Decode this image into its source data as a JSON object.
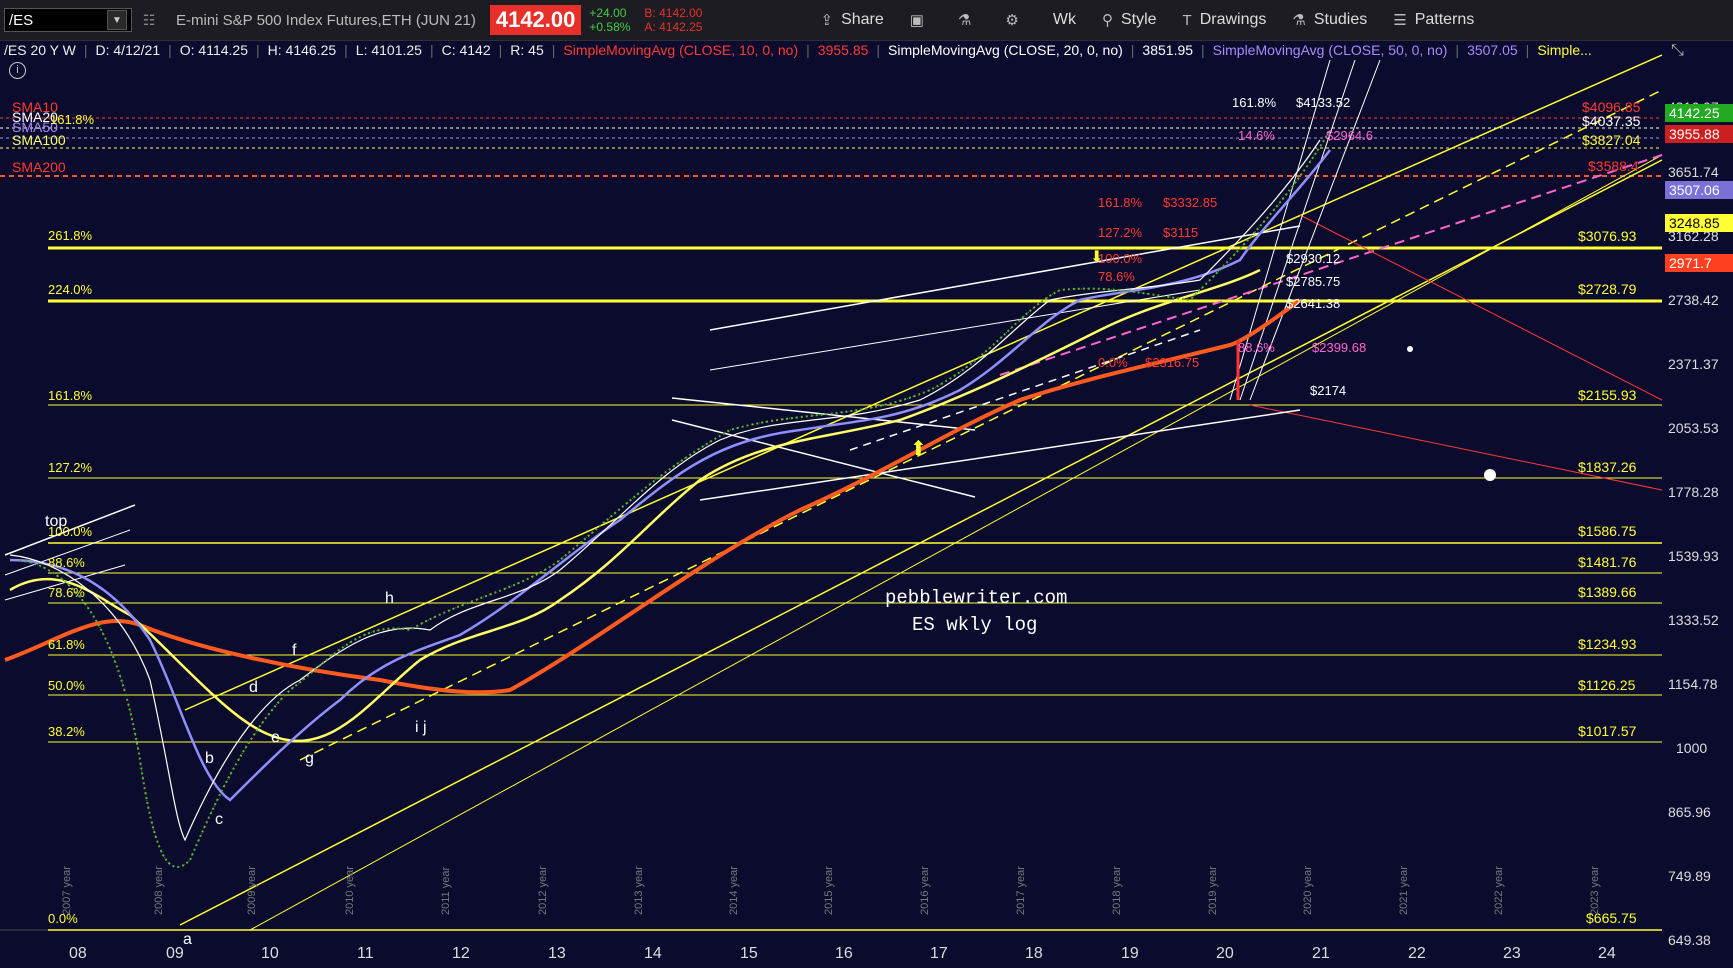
{
  "toolbar": {
    "symbol": "/ES",
    "instrument": "E-mini S&P 500 Index Futures,ETH (JUN 21)",
    "last_price": "4142.00",
    "change_abs": "+24.00",
    "change_pct": "+0.58%",
    "bid": "B: 4142.00",
    "ask": "A: 4142.25",
    "share": "Share",
    "timeframe": "Wk",
    "style": "Style",
    "drawings": "Drawings",
    "studies": "Studies",
    "patterns": "Patterns"
  },
  "legend": {
    "symbol_period": "/ES 20 Y W",
    "date": "D: 4/12/21",
    "open": "O: 4114.25",
    "high": "H: 4146.25",
    "low": "L: 4101.25",
    "close": "C: 4142",
    "range": "R: 45",
    "sma10_label": "SimpleMovingAvg (CLOSE, 10, 0, no)",
    "sma10_value": "3955.85",
    "sma20_label": "SimpleMovingAvg (CLOSE, 20, 0, no)",
    "sma20_value": "3851.95",
    "sma50_label": "SimpleMovingAvg (CLOSE, 50, 0, no)",
    "sma50_value": "3507.05",
    "more": "Simple..."
  },
  "colors": {
    "background": "#0b0b2e",
    "accent_yellow": "#ffff33",
    "sma10": "#ff3b30",
    "sma20": "#ffffff",
    "sma50": "#a78bfa",
    "sma100": "#ffff66",
    "sma200": "#ff5a1f",
    "up": "#33cc33",
    "down": "#ff3333"
  },
  "watermark": [
    "pebblewriter.com",
    "ES wkly log"
  ],
  "sma_labels": [
    "SMA10",
    "SMA20",
    "SMA50",
    "SMA100",
    "SMA200"
  ],
  "left_fib_labels": [
    "261.8%",
    "224.0%",
    "161.8%",
    "127.2%",
    "100.0%",
    "88.6%",
    "78.6%",
    "61.8%",
    "50.0%",
    "38.2%",
    "0.0%",
    "161.8%"
  ],
  "wave_labels": [
    "top",
    "a",
    "b",
    "c",
    "d",
    "e",
    "f",
    "g",
    "h",
    "i j"
  ],
  "fib_price_labels": [
    "$4096.85",
    "$4037.35",
    "$3827.04",
    "$3588.4",
    "$3076.93",
    "$2728.79",
    "$2155.93",
    "$1837.26",
    "$1586.75",
    "$1481.76",
    "$1389.66",
    "$1234.93",
    "$1126.25",
    "$1017.57",
    "$665.75"
  ],
  "axis_y_labels": [
    "4316.07",
    "3651.74",
    "3162.28",
    "2738.42",
    "2371.37",
    "2053.53",
    "1778.28",
    "1539.93",
    "1333.52",
    "1154.78",
    "1000",
    "865.96",
    "749.89",
    "649.38"
  ],
  "axis_badges": [
    "4142.25",
    "3955.88",
    "3507.06",
    "3248.85",
    "2971.7"
  ],
  "x_labels": [
    "08",
    "09",
    "10",
    "11",
    "12",
    "13",
    "14",
    "15",
    "16",
    "17",
    "18",
    "19",
    "20",
    "21",
    "22",
    "23",
    "24"
  ],
  "year_labels": [
    "2007 year",
    "2008 year",
    "2009 year",
    "2010 year",
    "2011 year",
    "2012 year",
    "2013 year",
    "2014 year",
    "2015 year",
    "2016 year",
    "2017 year",
    "2018 year",
    "2019 year",
    "2020 year",
    "2021 year",
    "2022 year",
    "2023 year"
  ],
  "cluster_labels": [
    "161.8%",
    "$3332.85",
    "127.2%",
    "$3115",
    "100.0%",
    "78.6%",
    "0.0%",
    "$2316.75",
    "$2930.12",
    "$2785.75",
    "$2641.38",
    "$2399.68",
    "$2174",
    "88.6%",
    "14.6%",
    "$2964.6",
    "161.8%",
    "$4133.52"
  ]
}
